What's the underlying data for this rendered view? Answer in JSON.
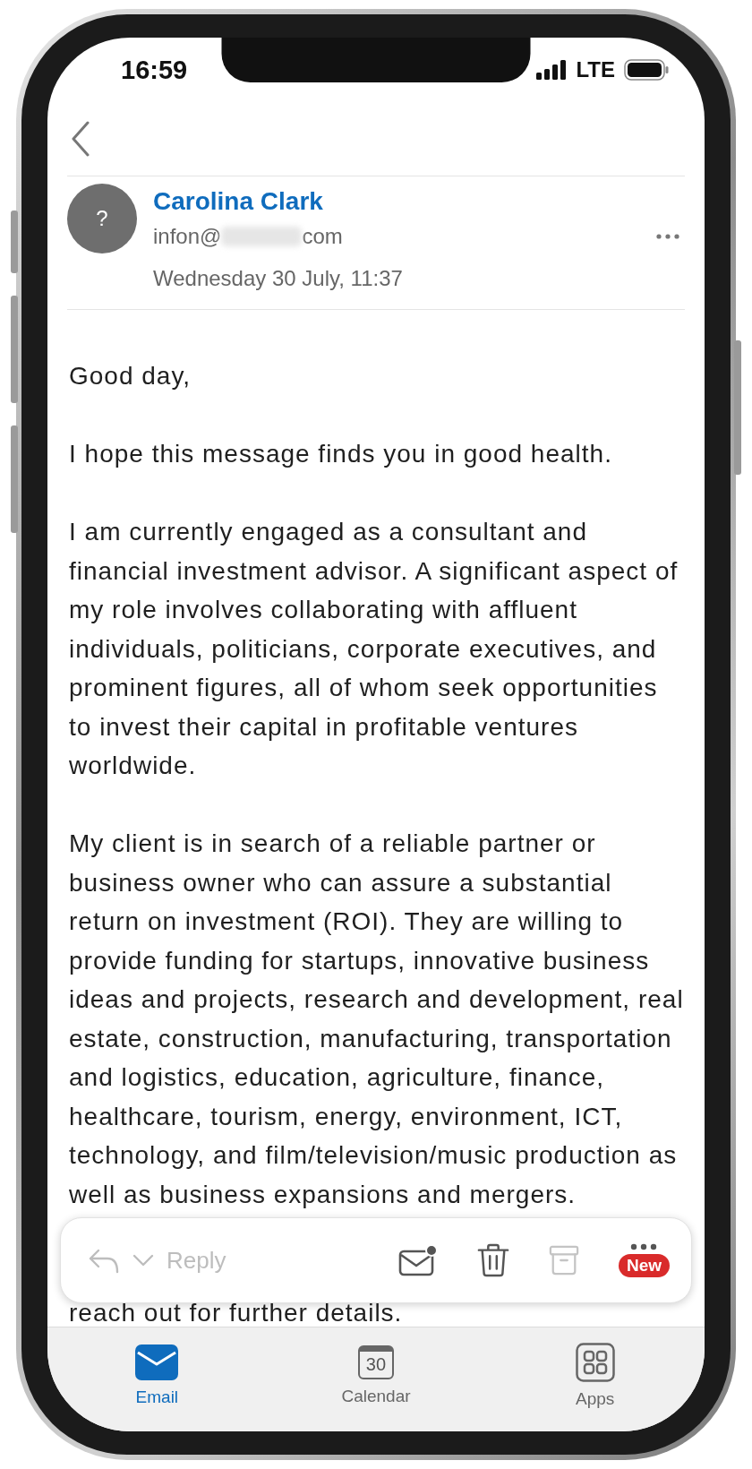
{
  "status_bar": {
    "time": "16:59",
    "network": "LTE"
  },
  "message": {
    "sender_name": "Carolina Clark",
    "avatar_text": "?",
    "email_start": "infon@",
    "email_end": "com",
    "date": "Wednesday 30 July, 11:37"
  },
  "body": {
    "paragraphs": [
      "Good day,",
      "I hope this message finds you in good health.",
      "I am currently engaged as a consultant and financial investment advisor. A significant aspect of my role involves collaborating with affluent individuals, politicians, corporate executives, and prominent figures, all of whom seek opportunities to invest their capital in profitable ventures worldwide.",
      "My client is in search of a reliable partner or business owner who can assure a substantial return on investment (ROI). They are willing to provide funding for startups, innovative business ideas and projects, research and development, real estate, construction, manufacturing, transportation and logistics, education, agriculture, finance, healthcare, tourism, energy, environment, ICT, technology, and film/television/music production as well as business expansions and mergers."
    ],
    "trailing_text": "reach out for further details."
  },
  "toolbar": {
    "reply_label": "Reply",
    "reply_disabled": true,
    "actions": [
      {
        "kind": "unread",
        "disabled": false
      },
      {
        "kind": "delete",
        "disabled": false
      },
      {
        "kind": "archive",
        "disabled": true
      },
      {
        "kind": "more",
        "disabled": false,
        "badge": "New"
      }
    ]
  },
  "tabs": [
    {
      "kind": "email",
      "label": "Email",
      "selected": true
    },
    {
      "kind": "calendar",
      "label": "Calendar",
      "icon_text": "30",
      "selected": false
    },
    {
      "kind": "apps",
      "label": "Apps",
      "selected": false
    }
  ]
}
